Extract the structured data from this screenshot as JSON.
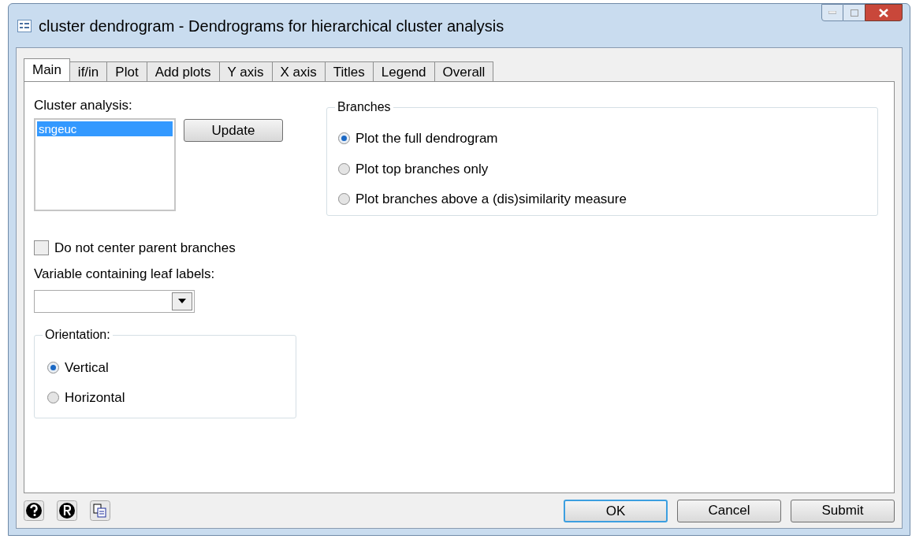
{
  "window": {
    "title": "cluster dendrogram - Dendrograms for hierarchical cluster analysis"
  },
  "tabs": [
    {
      "label": "Main",
      "selected": true
    },
    {
      "label": "if/in",
      "selected": false
    },
    {
      "label": "Plot",
      "selected": false
    },
    {
      "label": "Add plots",
      "selected": false
    },
    {
      "label": "Y axis",
      "selected": false
    },
    {
      "label": "X axis",
      "selected": false
    },
    {
      "label": "Titles",
      "selected": false
    },
    {
      "label": "Legend",
      "selected": false
    },
    {
      "label": "Overall",
      "selected": false
    }
  ],
  "cluster_analysis": {
    "label": "Cluster analysis:",
    "items": [
      {
        "label": "sngeuc",
        "selected": true
      }
    ],
    "update_button": "Update"
  },
  "center_checkbox": {
    "label": "Do not center parent branches",
    "checked": false
  },
  "leaf_labels": {
    "label": "Variable containing leaf labels:"
  },
  "orientation": {
    "legend": "Orientation:",
    "options": [
      {
        "label": "Vertical",
        "selected": true
      },
      {
        "label": "Horizontal",
        "selected": false
      }
    ]
  },
  "branches": {
    "legend": "Branches",
    "options": [
      {
        "label": "Plot the full dendrogram",
        "selected": true
      },
      {
        "label": "Plot top branches only",
        "selected": false
      },
      {
        "label": "Plot branches above a (dis)similarity measure",
        "selected": false
      }
    ]
  },
  "buttons": [
    {
      "label": "OK",
      "default": true
    },
    {
      "label": "Cancel",
      "default": false
    },
    {
      "label": "Submit",
      "default": false
    }
  ]
}
